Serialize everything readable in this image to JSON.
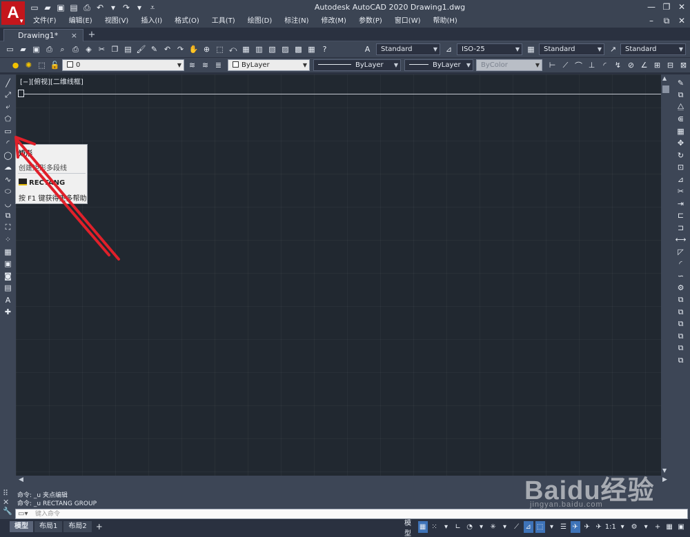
{
  "titlebar": {
    "app_logo": "A",
    "title": "Autodesk AutoCAD 2020    Drawing1.dwg"
  },
  "menu": [
    "文件(F)",
    "编辑(E)",
    "视图(V)",
    "插入(I)",
    "格式(O)",
    "工具(T)",
    "绘图(D)",
    "标注(N)",
    "修改(M)",
    "参数(P)",
    "窗口(W)",
    "帮助(H)"
  ],
  "tabs": {
    "active": "Drawing1*",
    "close": "×",
    "add": "+"
  },
  "toolbar1": {
    "text_style": "Standard",
    "dim_style": "ISO-25",
    "table_style": "Standard",
    "multileader_style": "Standard"
  },
  "toolbar2": {
    "layer": "0",
    "color": "ByLayer",
    "linetype": "ByLayer",
    "lineweight": "ByLayer",
    "plot_style": "ByColor"
  },
  "viewport": {
    "label": "[−][俯视][二维线框]"
  },
  "tooltip": {
    "title": "矩形",
    "description": "创建矩形多段线",
    "command": "RECTANG",
    "help": "按 F1 键获得更多帮助"
  },
  "command_history": [
    "命令: _u 夹点编辑",
    "命令: _u RECTANG GROUP"
  ],
  "command_input": {
    "placeholder": "键入命令"
  },
  "layout_tabs": [
    "模型",
    "布局1",
    "布局2"
  ],
  "status": {
    "model": "模型",
    "scale": "1:1"
  },
  "watermark": {
    "brand": "Baidu经验",
    "url": "jingyan.baidu.com"
  },
  "colors": {
    "accent": "#c4161c",
    "arrow": "#e0202a",
    "canvas": "#212830",
    "chrome": "#3d4656"
  }
}
